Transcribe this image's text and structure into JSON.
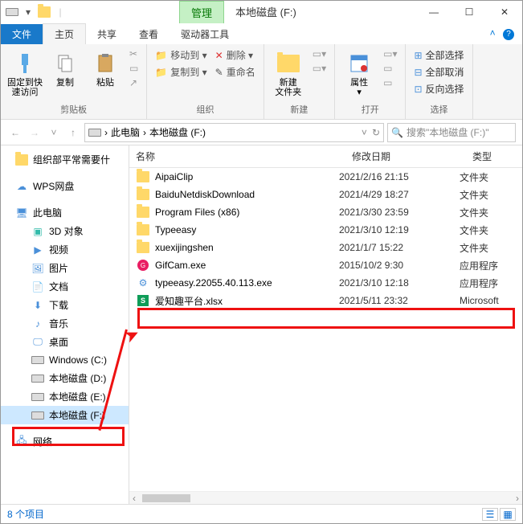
{
  "title_tabs": {
    "manage": "管理",
    "drive": "本地磁盘 (F:)",
    "tool": "驱动器工具"
  },
  "ribbon_tabs": {
    "file": "文件",
    "home": "主页",
    "share": "共享",
    "view": "查看"
  },
  "help_caret": "^",
  "ribbon": {
    "pin": "固定到快\n速访问",
    "copy": "复制",
    "paste": "粘贴",
    "clipboard": "剪贴板",
    "moveto": "移动到 ▾",
    "copyto": "复制到 ▾",
    "rename": "重命名",
    "delete": "删除 ▾",
    "org": "组织",
    "newfolder": "新建\n文件夹",
    "new": "新建",
    "props": "属性\n▾",
    "open": "打开",
    "selectall": "全部选择",
    "selectnone": "全部取消",
    "invert": "反向选择",
    "select": "选择"
  },
  "nav": {
    "pc": "此电脑",
    "drive": "本地磁盘 (F:)",
    "search_placeholder": "搜索\"本地磁盘 (F:)\""
  },
  "tree": [
    {
      "icon": "folder",
      "label": "组织部平常需要什",
      "lvl": 1
    },
    {
      "icon": "cloud",
      "label": "WPS网盘",
      "lvl": 1,
      "gapbefore": true
    },
    {
      "icon": "pc",
      "label": "此电脑",
      "lvl": 1,
      "gapbefore": true
    },
    {
      "icon": "3d",
      "label": "3D 对象",
      "lvl": 2
    },
    {
      "icon": "video",
      "label": "视频",
      "lvl": 2
    },
    {
      "icon": "pic",
      "label": "图片",
      "lvl": 2
    },
    {
      "icon": "doc",
      "label": "文档",
      "lvl": 2
    },
    {
      "icon": "down",
      "label": "下载",
      "lvl": 2
    },
    {
      "icon": "music",
      "label": "音乐",
      "lvl": 2
    },
    {
      "icon": "desk",
      "label": "桌面",
      "lvl": 2
    },
    {
      "icon": "drive",
      "label": "Windows (C:)",
      "lvl": 2
    },
    {
      "icon": "drive",
      "label": "本地磁盘 (D:)",
      "lvl": 2
    },
    {
      "icon": "drive",
      "label": "本地磁盘 (E:)",
      "lvl": 2
    },
    {
      "icon": "drive",
      "label": "本地磁盘 (F:)",
      "lvl": 2,
      "sel": true
    },
    {
      "icon": "net",
      "label": "网络",
      "lvl": 1,
      "gapbefore": true
    }
  ],
  "columns": {
    "name": "名称",
    "date": "修改日期",
    "type": "类型"
  },
  "rows": [
    {
      "icon": "folder",
      "name": "AipaiClip",
      "date": "2021/2/16 21:15",
      "type": "文件夹"
    },
    {
      "icon": "folder",
      "name": "BaiduNetdiskDownload",
      "date": "2021/4/29 18:27",
      "type": "文件夹"
    },
    {
      "icon": "folder",
      "name": "Program Files (x86)",
      "date": "2021/3/30 23:59",
      "type": "文件夹"
    },
    {
      "icon": "folder",
      "name": "Typeeasy",
      "date": "2021/3/10 12:19",
      "type": "文件夹"
    },
    {
      "icon": "folder",
      "name": "xuexijingshen",
      "date": "2021/1/7 15:22",
      "type": "文件夹"
    },
    {
      "icon": "gif",
      "name": "GifCam.exe",
      "date": "2015/10/2 9:30",
      "type": "应用程序"
    },
    {
      "icon": "exe",
      "name": "typeeasy.22055.40.113.exe",
      "date": "2021/3/10 12:18",
      "type": "应用程序"
    },
    {
      "icon": "xlsx",
      "name": "爱知趣平台.xlsx",
      "date": "2021/5/11 23:32",
      "type": "Microsoft"
    }
  ],
  "status": "8 个项目"
}
